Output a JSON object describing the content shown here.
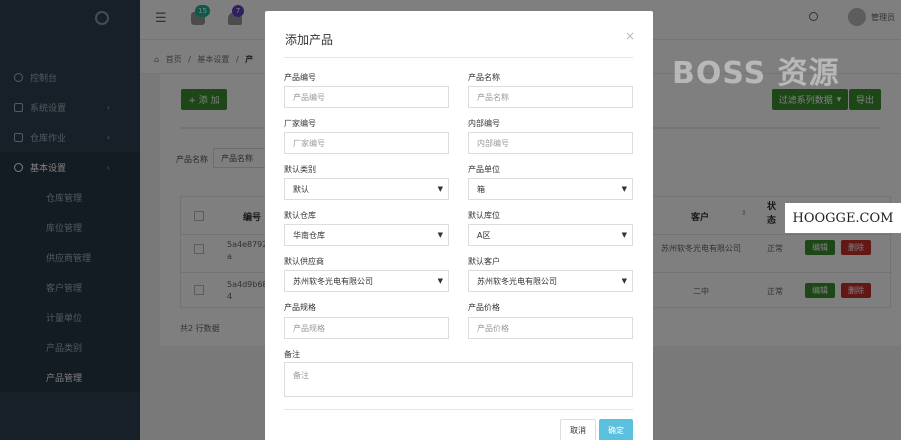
{
  "sidebar": {
    "items": [
      {
        "label": "控制台",
        "icon": "dashboard-icon",
        "chevron": ""
      },
      {
        "label": "系统设置",
        "icon": "monitor-icon",
        "chevron": "‹"
      },
      {
        "label": "仓库作业",
        "icon": "warehouse-icon",
        "chevron": "‹"
      },
      {
        "label": "基本设置",
        "icon": "gear-icon",
        "chevron": "‹"
      }
    ],
    "subitems": [
      "仓库管理",
      "库位管理",
      "供应商管理",
      "客户管理",
      "计量单位",
      "产品类别",
      "产品管理"
    ]
  },
  "topbar": {
    "badges": [
      "15",
      "7"
    ],
    "user": "管理员"
  },
  "breadcrumb": [
    "首页",
    "基本设置",
    "产"
  ],
  "toolbar": {
    "add": "+ 添 加",
    "filter": "过滤系列数据",
    "export": "导出"
  },
  "filter": {
    "label": "产品名称",
    "value": "产品名称"
  },
  "table": {
    "headers": {
      "code": "编号",
      "customer": "客户",
      "status": "状\n态"
    },
    "rows": [
      {
        "code": "5a4e8792a\na",
        "customer": "苏州软冬光电有限公司",
        "status": "正常",
        "edit": "编辑",
        "delete": "删除"
      },
      {
        "code": "5a4d9b68\n4",
        "customer": "二中",
        "status": "正常",
        "edit": "编辑",
        "delete": "删除"
      }
    ],
    "footer": "共2 行数据"
  },
  "watermark": {
    "text": "BOSS 资源",
    "site": "HOOGGE.COM"
  },
  "modal": {
    "title": "添加产品",
    "close": "×",
    "fields": {
      "code_label": "产品编号",
      "code_ph": "产品编号",
      "name_label": "产品名称",
      "name_ph": "产品名称",
      "factory_label": "厂家编号",
      "factory_ph": "厂家编号",
      "internal_label": "内部编号",
      "internal_ph": "内部编号",
      "category_label": "默认类别",
      "category_val": "默认",
      "unit_label": "产品单位",
      "unit_val": "箱",
      "warehouse_label": "默认仓库",
      "warehouse_val": "华南仓库",
      "location_label": "默认库位",
      "location_val": "A区",
      "supplier_label": "默认供应商",
      "supplier_val": "苏州软冬光电有限公司",
      "customer_label": "默认客户",
      "customer_val": "苏州软冬光电有限公司",
      "spec_label": "产品规格",
      "spec_ph": "产品规格",
      "price_label": "产品价格",
      "price_ph": "产品价格",
      "note_label": "备注",
      "note_ph": "备注"
    },
    "cancel": "取消",
    "ok": "确定"
  }
}
